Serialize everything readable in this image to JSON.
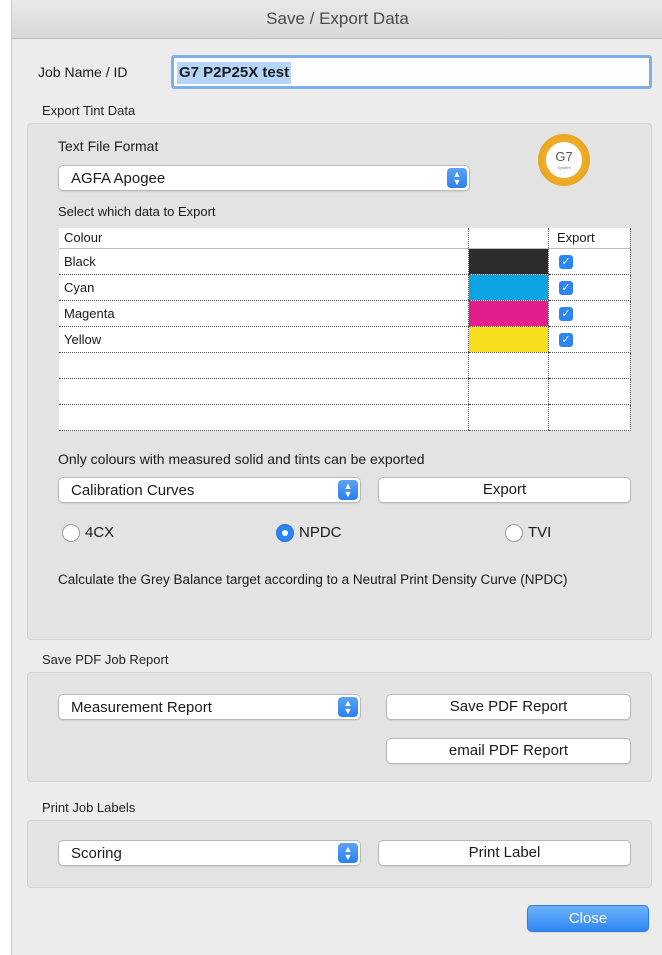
{
  "window": {
    "title": "Save / Export Data"
  },
  "job": {
    "label": "Job Name / ID",
    "value": "G7 P2P25X test"
  },
  "export_tint": {
    "section_title": "Export Tint Data",
    "format_label": "Text File Format",
    "format_value": "AGFA Apogee",
    "badge": {
      "text": "G7",
      "sub": "System"
    },
    "select_label": "Select which data to Export",
    "table": {
      "headers": [
        "Colour",
        "",
        "Export"
      ],
      "rows": [
        {
          "name": "Black",
          "color": "#2c2c2c",
          "export": true
        },
        {
          "name": "Cyan",
          "color": "#0ba4e2",
          "export": true
        },
        {
          "name": "Magenta",
          "color": "#e31d8c",
          "export": true
        },
        {
          "name": "Yellow",
          "color": "#f7df1d",
          "export": true
        }
      ]
    },
    "note": "Only colours with measured solid and tints can be exported",
    "curve_value": "Calibration Curves",
    "export_button": "Export",
    "radios": [
      {
        "label": "4CX",
        "selected": false
      },
      {
        "label": "NPDC",
        "selected": true
      },
      {
        "label": "TVI",
        "selected": false
      }
    ],
    "description": "Calculate the Grey Balance target according to a Neutral Print Density Curve (NPDC)"
  },
  "pdf_report": {
    "section_title": "Save PDF Job Report",
    "report_value": "Measurement Report",
    "save_button": "Save PDF Report",
    "email_button": "email PDF Report"
  },
  "labels": {
    "section_title": "Print Job Labels",
    "label_value": "Scoring",
    "print_button": "Print Label"
  },
  "close_button": "Close",
  "colors": {
    "accent": "#2b86f1",
    "selection": "#b5d5fb",
    "focus_ring": "#7fb0ec"
  }
}
